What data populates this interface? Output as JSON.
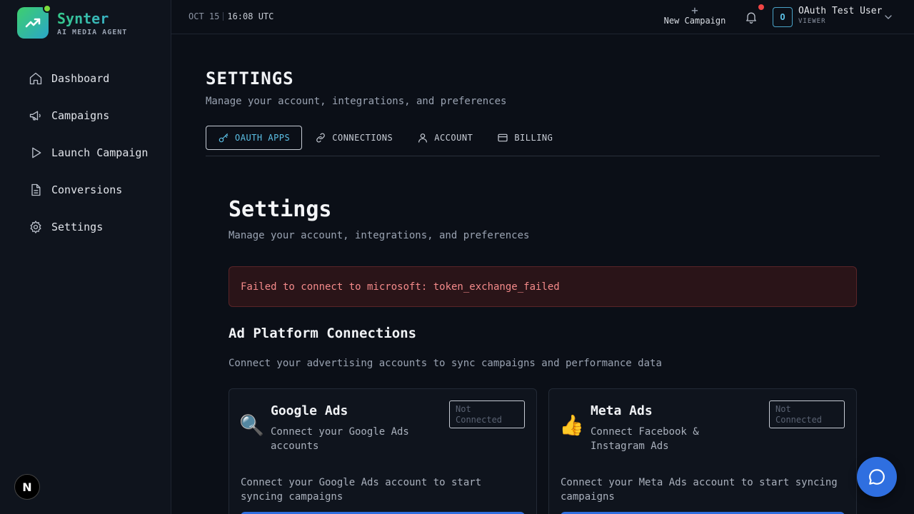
{
  "brand": {
    "name": "Synter",
    "subtitle": "AI MEDIA AGENT"
  },
  "sidebar": {
    "items": [
      {
        "label": "Dashboard",
        "icon": "home-icon"
      },
      {
        "label": "Campaigns",
        "icon": "megaphone-icon"
      },
      {
        "label": "Launch Campaign",
        "icon": "play-icon"
      },
      {
        "label": "Conversions",
        "icon": "document-icon"
      },
      {
        "label": "Settings",
        "icon": "gear-icon"
      }
    ],
    "badge_letter": "N"
  },
  "topbar": {
    "date": "OCT 15",
    "time": "16:08 UTC",
    "new_campaign_label": "New Campaign",
    "user": {
      "initial": "O",
      "name": "OAuth Test User",
      "role": "VIEWER"
    }
  },
  "page": {
    "title": "SETTINGS",
    "subtitle": "Manage your account, integrations, and preferences",
    "tabs": [
      {
        "label": "OAUTH APPS",
        "icon": "key-icon",
        "active": true
      },
      {
        "label": "CONNECTIONS",
        "icon": "link-icon",
        "active": false
      },
      {
        "label": "ACCOUNT",
        "icon": "user-icon",
        "active": false
      },
      {
        "label": "BILLING",
        "icon": "credit-card-icon",
        "active": false
      }
    ]
  },
  "content": {
    "title": "Settings",
    "subtitle": "Manage your account, integrations, and preferences",
    "error": "Failed to connect to microsoft: token_exchange_failed",
    "section_title": "Ad Platform Connections",
    "section_subtitle": "Connect your advertising accounts to sync campaigns and performance data",
    "cards": [
      {
        "emoji": "🔍",
        "name": "Google Ads",
        "description": "Connect your Google Ads accounts",
        "status": "Not Connected",
        "body": "Connect your Google Ads account to start syncing campaigns"
      },
      {
        "emoji": "👍",
        "name": "Meta Ads",
        "description": "Connect Facebook & Instagram Ads",
        "status": "Not Connected",
        "body": "Connect your Meta Ads account to start syncing campaigns"
      }
    ]
  },
  "colors": {
    "accent": "#5cc0e6",
    "primary_button": "#2f6fe0",
    "error_text": "#f48a8a",
    "notification": "#ef4444"
  }
}
